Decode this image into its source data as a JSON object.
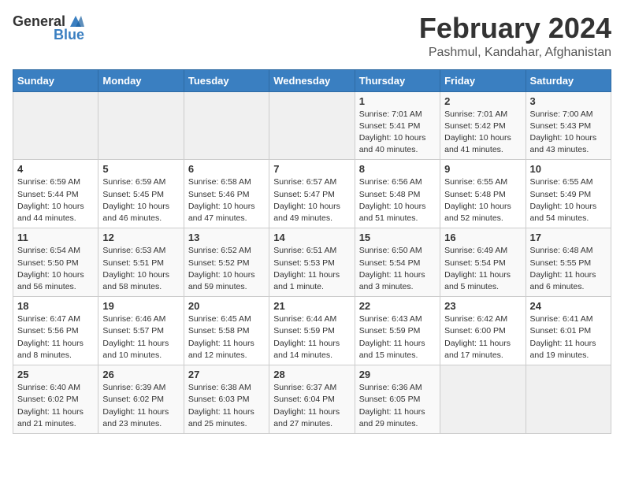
{
  "header": {
    "logo_general": "General",
    "logo_blue": "Blue",
    "title": "February 2024",
    "subtitle": "Pashmul, Kandahar, Afghanistan"
  },
  "calendar": {
    "headers": [
      "Sunday",
      "Monday",
      "Tuesday",
      "Wednesday",
      "Thursday",
      "Friday",
      "Saturday"
    ],
    "rows": [
      [
        {
          "day": "",
          "info": ""
        },
        {
          "day": "",
          "info": ""
        },
        {
          "day": "",
          "info": ""
        },
        {
          "day": "",
          "info": ""
        },
        {
          "day": "1",
          "info": "Sunrise: 7:01 AM\nSunset: 5:41 PM\nDaylight: 10 hours\nand 40 minutes."
        },
        {
          "day": "2",
          "info": "Sunrise: 7:01 AM\nSunset: 5:42 PM\nDaylight: 10 hours\nand 41 minutes."
        },
        {
          "day": "3",
          "info": "Sunrise: 7:00 AM\nSunset: 5:43 PM\nDaylight: 10 hours\nand 43 minutes."
        }
      ],
      [
        {
          "day": "4",
          "info": "Sunrise: 6:59 AM\nSunset: 5:44 PM\nDaylight: 10 hours\nand 44 minutes."
        },
        {
          "day": "5",
          "info": "Sunrise: 6:59 AM\nSunset: 5:45 PM\nDaylight: 10 hours\nand 46 minutes."
        },
        {
          "day": "6",
          "info": "Sunrise: 6:58 AM\nSunset: 5:46 PM\nDaylight: 10 hours\nand 47 minutes."
        },
        {
          "day": "7",
          "info": "Sunrise: 6:57 AM\nSunset: 5:47 PM\nDaylight: 10 hours\nand 49 minutes."
        },
        {
          "day": "8",
          "info": "Sunrise: 6:56 AM\nSunset: 5:48 PM\nDaylight: 10 hours\nand 51 minutes."
        },
        {
          "day": "9",
          "info": "Sunrise: 6:55 AM\nSunset: 5:48 PM\nDaylight: 10 hours\nand 52 minutes."
        },
        {
          "day": "10",
          "info": "Sunrise: 6:55 AM\nSunset: 5:49 PM\nDaylight: 10 hours\nand 54 minutes."
        }
      ],
      [
        {
          "day": "11",
          "info": "Sunrise: 6:54 AM\nSunset: 5:50 PM\nDaylight: 10 hours\nand 56 minutes."
        },
        {
          "day": "12",
          "info": "Sunrise: 6:53 AM\nSunset: 5:51 PM\nDaylight: 10 hours\nand 58 minutes."
        },
        {
          "day": "13",
          "info": "Sunrise: 6:52 AM\nSunset: 5:52 PM\nDaylight: 10 hours\nand 59 minutes."
        },
        {
          "day": "14",
          "info": "Sunrise: 6:51 AM\nSunset: 5:53 PM\nDaylight: 11 hours\nand 1 minute."
        },
        {
          "day": "15",
          "info": "Sunrise: 6:50 AM\nSunset: 5:54 PM\nDaylight: 11 hours\nand 3 minutes."
        },
        {
          "day": "16",
          "info": "Sunrise: 6:49 AM\nSunset: 5:54 PM\nDaylight: 11 hours\nand 5 minutes."
        },
        {
          "day": "17",
          "info": "Sunrise: 6:48 AM\nSunset: 5:55 PM\nDaylight: 11 hours\nand 6 minutes."
        }
      ],
      [
        {
          "day": "18",
          "info": "Sunrise: 6:47 AM\nSunset: 5:56 PM\nDaylight: 11 hours\nand 8 minutes."
        },
        {
          "day": "19",
          "info": "Sunrise: 6:46 AM\nSunset: 5:57 PM\nDaylight: 11 hours\nand 10 minutes."
        },
        {
          "day": "20",
          "info": "Sunrise: 6:45 AM\nSunset: 5:58 PM\nDaylight: 11 hours\nand 12 minutes."
        },
        {
          "day": "21",
          "info": "Sunrise: 6:44 AM\nSunset: 5:59 PM\nDaylight: 11 hours\nand 14 minutes."
        },
        {
          "day": "22",
          "info": "Sunrise: 6:43 AM\nSunset: 5:59 PM\nDaylight: 11 hours\nand 15 minutes."
        },
        {
          "day": "23",
          "info": "Sunrise: 6:42 AM\nSunset: 6:00 PM\nDaylight: 11 hours\nand 17 minutes."
        },
        {
          "day": "24",
          "info": "Sunrise: 6:41 AM\nSunset: 6:01 PM\nDaylight: 11 hours\nand 19 minutes."
        }
      ],
      [
        {
          "day": "25",
          "info": "Sunrise: 6:40 AM\nSunset: 6:02 PM\nDaylight: 11 hours\nand 21 minutes."
        },
        {
          "day": "26",
          "info": "Sunrise: 6:39 AM\nSunset: 6:02 PM\nDaylight: 11 hours\nand 23 minutes."
        },
        {
          "day": "27",
          "info": "Sunrise: 6:38 AM\nSunset: 6:03 PM\nDaylight: 11 hours\nand 25 minutes."
        },
        {
          "day": "28",
          "info": "Sunrise: 6:37 AM\nSunset: 6:04 PM\nDaylight: 11 hours\nand 27 minutes."
        },
        {
          "day": "29",
          "info": "Sunrise: 6:36 AM\nSunset: 6:05 PM\nDaylight: 11 hours\nand 29 minutes."
        },
        {
          "day": "",
          "info": ""
        },
        {
          "day": "",
          "info": ""
        }
      ]
    ]
  }
}
